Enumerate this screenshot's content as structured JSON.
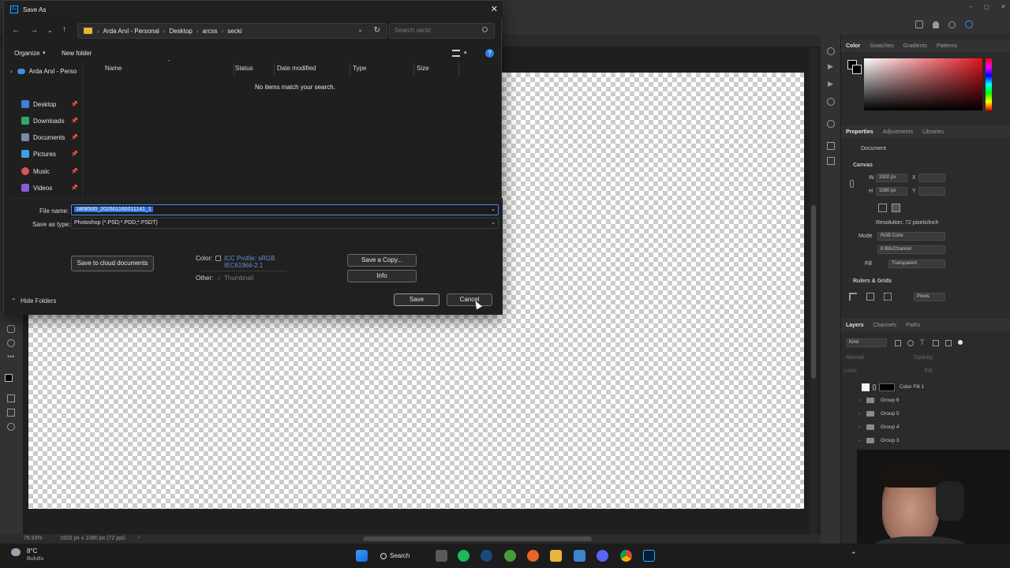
{
  "dialog": {
    "title": "Save As",
    "app_badge": "Ps",
    "breadcrumb": [
      "Arda Anıl - Personal",
      "Desktop",
      "arcss",
      "secki"
    ],
    "search_placeholder": "Search secki",
    "organize_label": "Organize",
    "new_folder_label": "New folder",
    "columns": [
      "Name",
      "Status",
      "Date modified",
      "Type",
      "Size"
    ],
    "empty_message": "No items match your search.",
    "nav": {
      "root": "Arda Anıl - Perso",
      "items": [
        {
          "label": "Desktop",
          "icon": "desktop-icon",
          "color": "#3b82d6"
        },
        {
          "label": "Downloads",
          "icon": "downloads-icon",
          "color": "#2fa86a"
        },
        {
          "label": "Documents",
          "icon": "documents-icon",
          "color": "#7a8ba5"
        },
        {
          "label": "Pictures",
          "icon": "pictures-icon",
          "color": "#3da0e0"
        },
        {
          "label": "Music",
          "icon": "music-icon",
          "color": "#d9534f"
        },
        {
          "label": "Videos",
          "icon": "videos-icon",
          "color": "#8a5cd6"
        }
      ]
    },
    "file_name_label": "File name:",
    "file_name_value": "1808500_202601160011141_1",
    "save_type_label": "Save as type:",
    "save_type_value": "Photoshop (*.PSD;*.PDD;*.PSDT)",
    "cloud_button": "Save to cloud documents",
    "color_label": "Color:",
    "icc_profile_line1": "ICC Profile:  sRGB",
    "icc_profile_line2": "IEC61966-2.1",
    "other_label": "Other:",
    "thumbnail_label": "Thumbnail",
    "save_copy_button": "Save a Copy...",
    "info_button": "Info",
    "hide_folders": "Hide Folders",
    "save_button": "Save",
    "cancel_button": "Cancel"
  },
  "photoshop": {
    "zoom": "76.93%",
    "doc_info": "1920 px x 1080 px (72 ppi)",
    "color_tabs": [
      "Color",
      "Swatches",
      "Gradients",
      "Patterns"
    ],
    "properties_tabs": [
      "Properties",
      "Adjustments",
      "Libraries"
    ],
    "document_label": "Document",
    "canvas_section": "Canvas",
    "width_label": "W",
    "width_value": "1920 px",
    "height_label": "H",
    "height_value": "1080 px",
    "x_label": "X",
    "y_label": "Y",
    "resolution": "Resolution: 72 pixels/inch",
    "mode_label": "Mode",
    "mode_value": "RGB Color",
    "bits_value": "8 Bits/Channel",
    "fill_label": "Fill",
    "fill_value": "Transparent",
    "rulers_section": "Rulers & Grids",
    "units_value": "Pixels",
    "layers_tabs": [
      "Layers",
      "Channels",
      "Paths"
    ],
    "kind_label": "Kind",
    "blend_mode": "Normal",
    "opacity_label": "Opacity:",
    "lock_label": "Lock:",
    "fill_small_label": "Fill:",
    "layers": [
      "Color Fill 1",
      "Group 6",
      "Group 5",
      "Group 4",
      "Group 3"
    ]
  },
  "taskbar": {
    "weather_temp": "8°C",
    "weather_desc": "Bulutlu",
    "search_label": "Search"
  }
}
